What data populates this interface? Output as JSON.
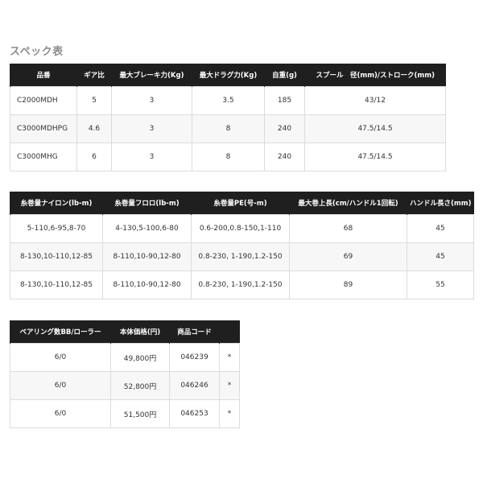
{
  "page": {
    "title": "スペック表"
  },
  "table1": {
    "headers": [
      "品番",
      "ギア比",
      "最大ブレーキ力(Kg)",
      "最大ドラグ力(Kg)",
      "自重(g)",
      "スプール　径(mm)/ストローク(mm)"
    ],
    "rows": [
      [
        "C2000MDH",
        "5",
        "3",
        "3.5",
        "185",
        "43/12"
      ],
      [
        "C3000MDHPG",
        "4.6",
        "3",
        "8",
        "240",
        "47.5/14.5"
      ],
      [
        "C3000MHG",
        "6",
        "3",
        "8",
        "240",
        "47.5/14.5"
      ]
    ]
  },
  "table2": {
    "headers": [
      "糸巻量ナイロン(lb-m)",
      "糸巻量フロロ(lb-m)",
      "糸巻量PE(号-m)",
      "最大巻上長(cm/ハンドル1回転)",
      "ハンドル長さ(mm)"
    ],
    "rows": [
      [
        "5-110,6-95,8-70",
        "4-130,5-100,6-80",
        "0.6-200,0.8-150,1-110",
        "68",
        "45"
      ],
      [
        "8-130,10-110,12-85",
        "8-110,10-90,12-80",
        "0.8-230, 1-190,1.2-150",
        "69",
        "45"
      ],
      [
        "8-130,10-110,12-85",
        "8-110,10-90,12-80",
        "0.8-230, 1-190,1.2-150",
        "89",
        "55"
      ]
    ]
  },
  "table3": {
    "headers": [
      "ベアリング数BB/ローラー",
      "本体価格(円)",
      "商品コード",
      ""
    ],
    "rows": [
      [
        "6/0",
        "49,800円",
        "046239",
        "*"
      ],
      [
        "6/0",
        "52,800円",
        "046246",
        "*"
      ],
      [
        "6/0",
        "51,500円",
        "046253",
        "*"
      ]
    ]
  }
}
